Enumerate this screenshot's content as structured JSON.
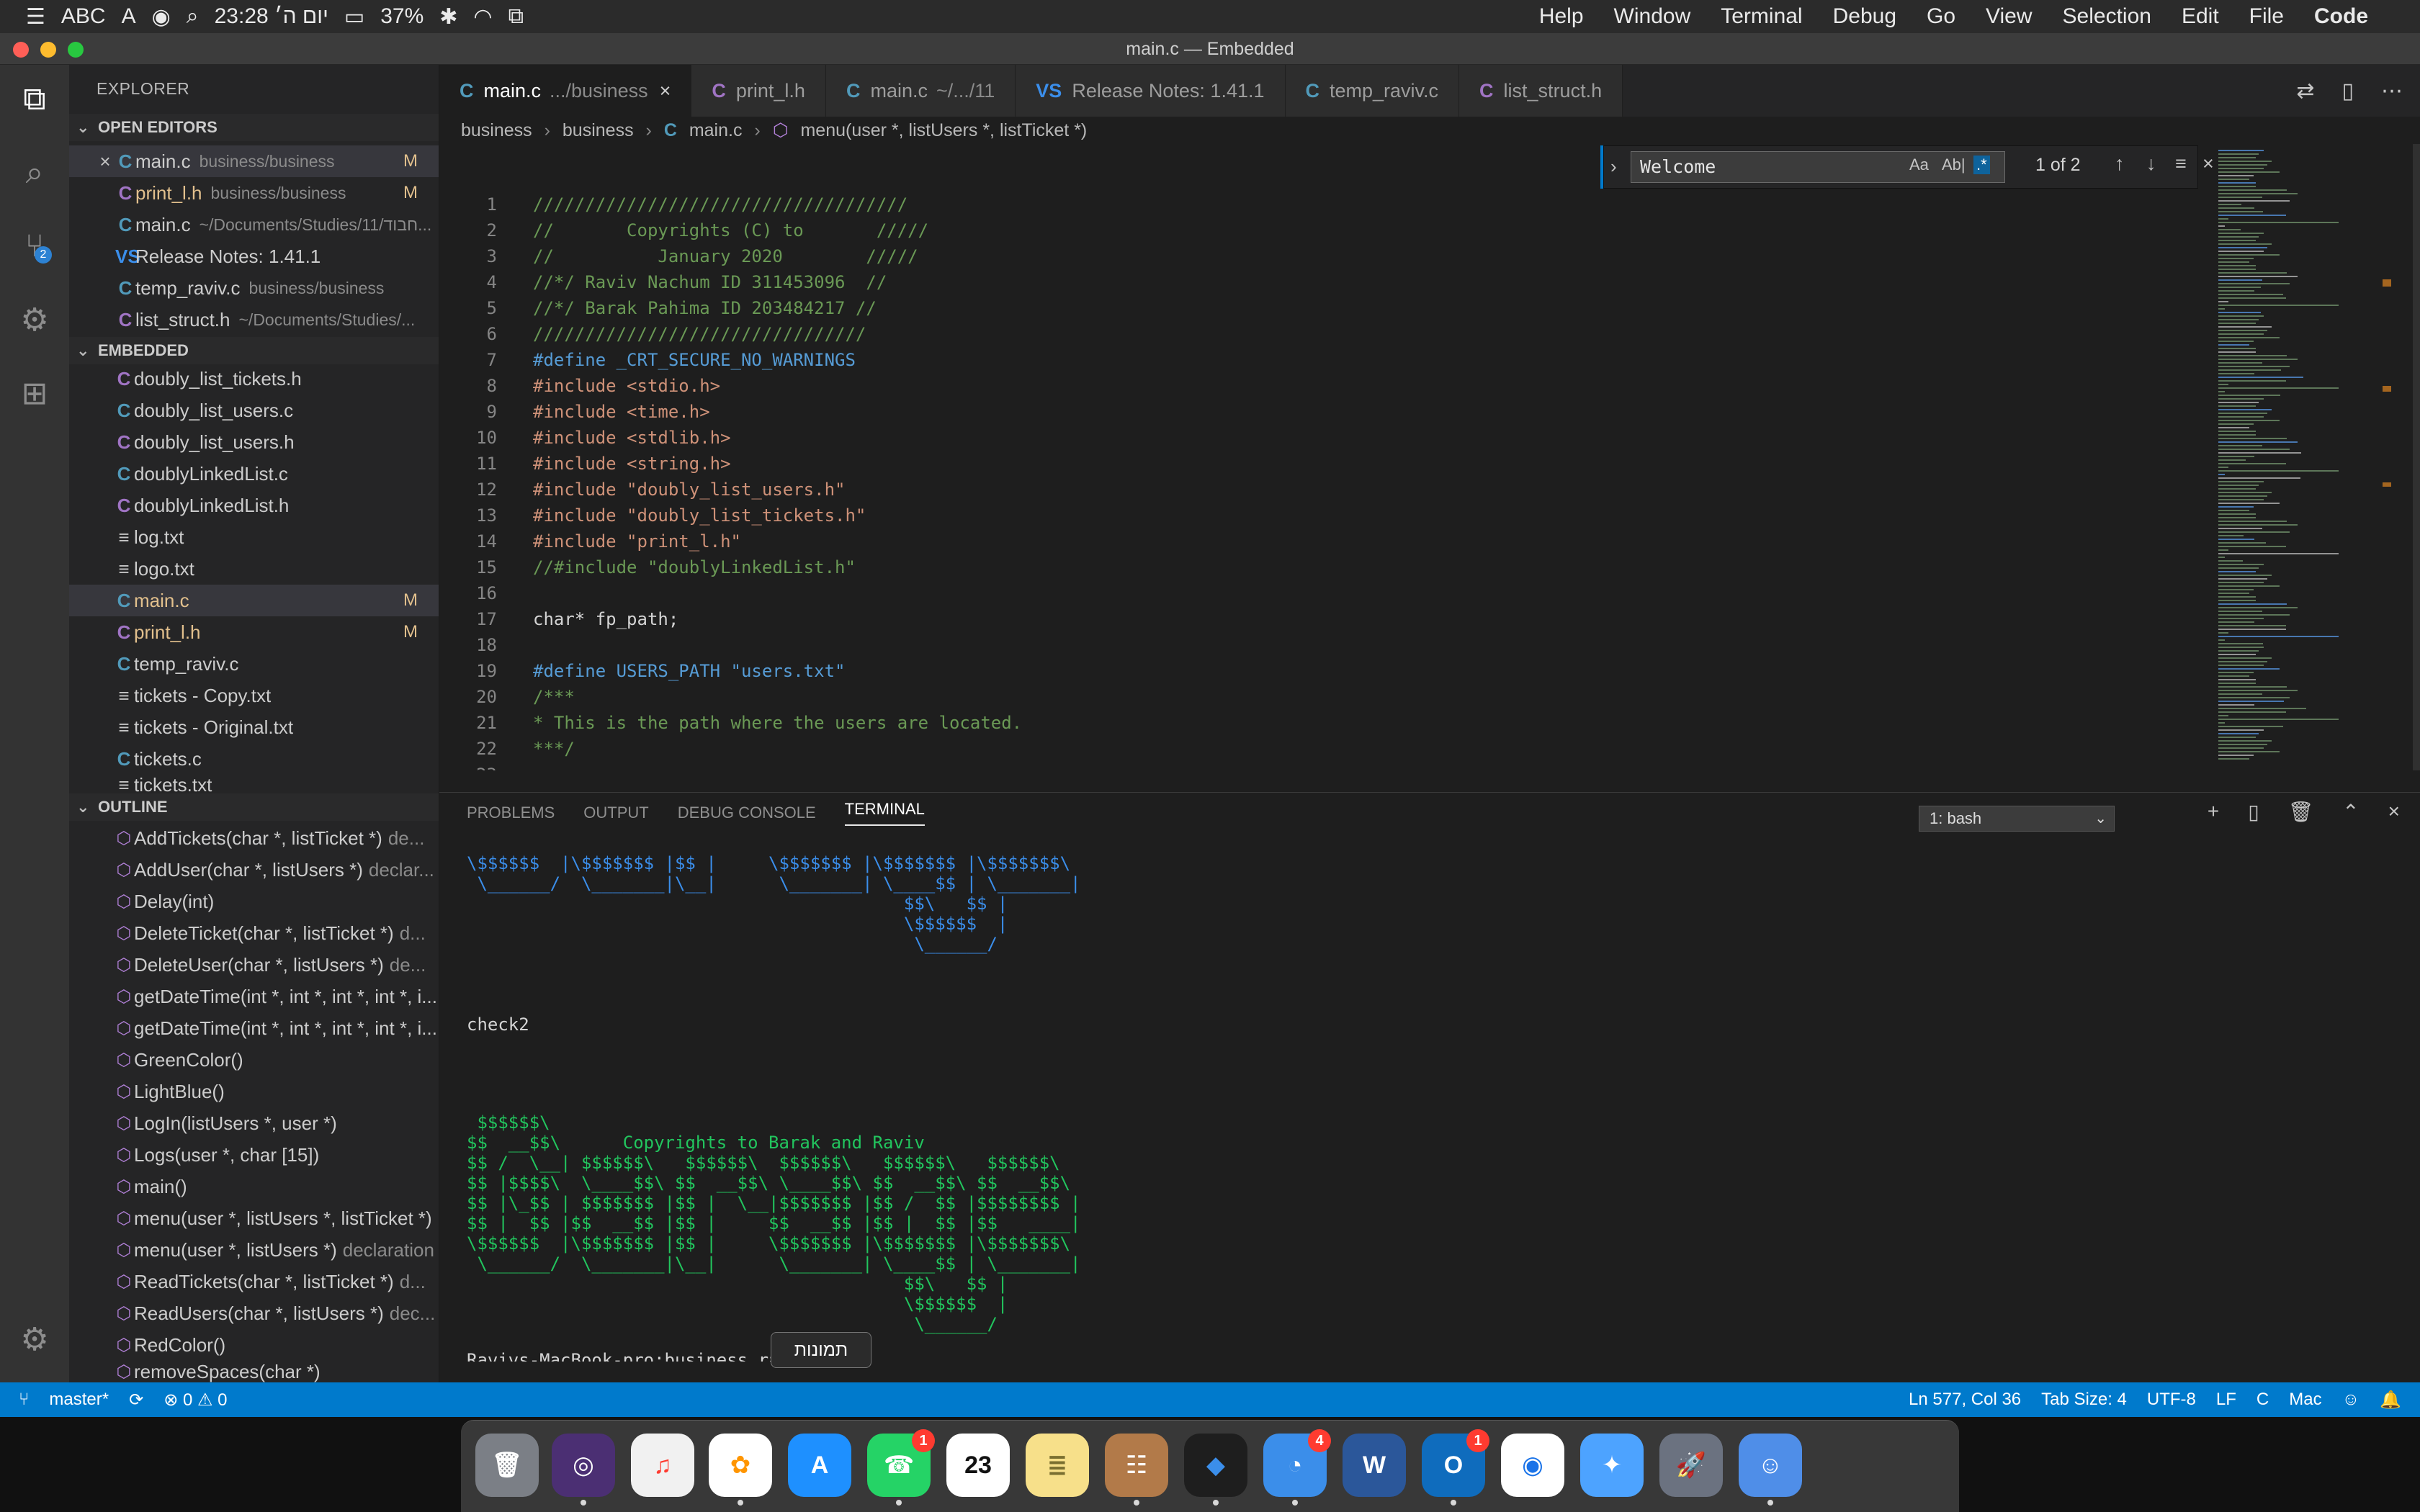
{
  "menubar": {
    "left": {
      "abc": "ABC",
      "a": "A",
      "time": "23:28 יום ה׳",
      "battery": "37%"
    },
    "right": [
      "Help",
      "Window",
      "Terminal",
      "Debug",
      "Go",
      "View",
      "Selection",
      "Edit",
      "File",
      "Code"
    ]
  },
  "window": {
    "title": "main.c — Embedded"
  },
  "sidebar": {
    "header": "EXPLORER",
    "open_editors": {
      "title": "OPEN EDITORS",
      "items": [
        {
          "icon": "C",
          "label": "main.c",
          "meta": "business/business",
          "mod": "M",
          "close": "×"
        },
        {
          "icon": "C",
          "label": "print_l.h",
          "meta": "business/business",
          "mod": "M"
        },
        {
          "icon": "C",
          "label": "main.c",
          "meta": "~/Documents/Studies/11/חבוד..."
        },
        {
          "icon": "VS",
          "label": "Release Notes: 1.41.1",
          "meta": ""
        },
        {
          "icon": "C",
          "label": "temp_raviv.c",
          "meta": "business/business"
        },
        {
          "icon": "C",
          "label": "list_struct.h",
          "meta": "~/Documents/Studies/..."
        }
      ]
    },
    "embedded": {
      "title": "EMBEDDED",
      "items": [
        {
          "icon": "C",
          "label": "doubly_list_tickets.h"
        },
        {
          "icon": "C",
          "label": "doubly_list_users.c"
        },
        {
          "icon": "C",
          "label": "doubly_list_users.h"
        },
        {
          "icon": "C",
          "label": "doublyLinkedList.c"
        },
        {
          "icon": "C",
          "label": "doublyLinkedList.h"
        },
        {
          "icon": "≡",
          "label": "log.txt"
        },
        {
          "icon": "≡",
          "label": "logo.txt"
        },
        {
          "icon": "C",
          "label": "main.c",
          "mod": "M"
        },
        {
          "icon": "C",
          "label": "print_l.h",
          "mod": "M"
        },
        {
          "icon": "C",
          "label": "temp_raviv.c"
        },
        {
          "icon": "≡",
          "label": "tickets - Copy.txt"
        },
        {
          "icon": "≡",
          "label": "tickets - Original.txt"
        },
        {
          "icon": "C",
          "label": "tickets.c"
        },
        {
          "icon": "≡",
          "label": "tickets.txt"
        }
      ]
    },
    "outline": {
      "title": "OUTLINE",
      "items": [
        {
          "label": "AddTickets(char *, listTicket *)",
          "meta": "de..."
        },
        {
          "label": "AddUser(char *, listUsers *)",
          "meta": "declar..."
        },
        {
          "label": "Delay(int)",
          "meta": ""
        },
        {
          "label": "DeleteTicket(char *, listTicket *)",
          "meta": "d..."
        },
        {
          "label": "DeleteUser(char *, listUsers *)",
          "meta": "de..."
        },
        {
          "label": "getDateTime(int *, int *, int *, int *, i...",
          "meta": ""
        },
        {
          "label": "getDateTime(int *, int *, int *, int *, i...",
          "meta": ""
        },
        {
          "label": "GreenColor()",
          "meta": ""
        },
        {
          "label": "LightBlue()",
          "meta": ""
        },
        {
          "label": "LogIn(listUsers *, user *)",
          "meta": ""
        },
        {
          "label": "Logs(user *, char [15])",
          "meta": ""
        },
        {
          "label": "main()",
          "meta": ""
        },
        {
          "label": "menu(user *, listUsers *, listTicket *)",
          "meta": ""
        },
        {
          "label": "menu(user *, listUsers *)",
          "meta": "declaration"
        },
        {
          "label": "ReadTickets(char *, listTicket *)",
          "meta": "d..."
        },
        {
          "label": "ReadUsers(char *, listUsers *)",
          "meta": "dec..."
        },
        {
          "label": "RedColor()",
          "meta": ""
        },
        {
          "label": "removeSpaces(char *)",
          "meta": ""
        }
      ]
    }
  },
  "tabs": [
    {
      "icon": "C",
      "label": "main.c",
      "desc": ".../business",
      "active": true,
      "close": "×"
    },
    {
      "icon": "C",
      "label": "print_l.h",
      "desc": ""
    },
    {
      "icon": "C",
      "label": "main.c",
      "desc": "~/.../11"
    },
    {
      "icon": "VS",
      "label": "Release Notes: 1.41.1",
      "desc": ""
    },
    {
      "icon": "C",
      "label": "temp_raviv.c",
      "desc": ""
    },
    {
      "icon": "C",
      "label": "list_struct.h",
      "desc": ""
    }
  ],
  "breadcrumb": {
    "parts": [
      "business",
      "business",
      "main.c",
      "menu(user *, listUsers *, listTicket *)"
    ]
  },
  "find": {
    "value": "Welcome",
    "count": "1 of 2",
    "opt_case": "Aa",
    "opt_word": "Ab|",
    "opt_regex": ".*"
  },
  "code": [
    {
      "ln": "1",
      "text": "////////////////////////////////////"
    },
    {
      "ln": "2",
      "text": "//       Copyrights (C) to       /////"
    },
    {
      "ln": "3",
      "text": "//          January 2020        /////"
    },
    {
      "ln": "4",
      "text": "//*/ Raviv Nachum ID 311453096  //"
    },
    {
      "ln": "5",
      "text": "//*/ Barak Pahima ID 203484217 //"
    },
    {
      "ln": "6",
      "text": "////////////////////////////////"
    },
    {
      "ln": "7",
      "text": "#define _CRT_SECURE_NO_WARNINGS"
    },
    {
      "ln": "8",
      "text": "#include <stdio.h>"
    },
    {
      "ln": "9",
      "text": "#include <time.h>"
    },
    {
      "ln": "10",
      "text": "#include <stdlib.h>"
    },
    {
      "ln": "11",
      "text": "#include <string.h>"
    },
    {
      "ln": "12",
      "text": "#include \"doubly_list_users.h\""
    },
    {
      "ln": "13",
      "text": "#include \"doubly_list_tickets.h\""
    },
    {
      "ln": "14",
      "text": "#include \"print_l.h\""
    },
    {
      "ln": "15",
      "text": "//#include \"doublyLinkedList.h\""
    },
    {
      "ln": "16",
      "text": ""
    },
    {
      "ln": "17",
      "text": "char* fp_path;"
    },
    {
      "ln": "18",
      "text": ""
    },
    {
      "ln": "19",
      "text": "#define USERS_PATH \"users.txt\""
    },
    {
      "ln": "20",
      "text": "/***"
    },
    {
      "ln": "21",
      "text": "* This is the path where the users are located."
    },
    {
      "ln": "22",
      "text": "***/"
    },
    {
      "ln": "23",
      "text": ""
    }
  ],
  "panel": {
    "tabs": [
      "PROBLEMS",
      "OUTPUT",
      "DEBUG CONSOLE",
      "TERMINAL"
    ],
    "terminal_select": "1: bash",
    "lines_blue": [
      "\\$$$$$$  |\\$$$$$$$ |$$ |     \\$$$$$$$ |\\$$$$$$$ |\\$$$$$$$\\",
      " \\______/  \\_______|\\__|      \\_______| \\____$$ | \\_______|",
      "                                          $$\\   $$ |",
      "                                          \\$$$$$$  |",
      "                                           \\______/"
    ],
    "check": "check2",
    "lines_green": [
      " $$$$$$\\",
      "$$  __$$\\      Copyrights to Barak and Raviv",
      "$$ /  \\__| $$$$$$\\   $$$$$$\\  $$$$$$\\   $$$$$$\\   $$$$$$\\",
      "$$ |$$$$\\  \\____$$\\ $$  __$$\\ \\____$$\\ $$  __$$\\ $$  __$$\\",
      "$$ |\\_$$ | $$$$$$$ |$$ |  \\__|$$$$$$$ |$$ /  $$ |$$$$$$$$ |",
      "$$ |  $$ |$$  __$$ |$$ |     $$  __$$ |$$ |  $$ |$$   ____|",
      "\\$$$$$$  |\\$$$$$$$ |$$ |     \\$$$$$$$ |\\$$$$$$$ |\\$$$$$$$\\",
      " \\______/  \\_______|\\__|      \\_______| \\____$$ | \\_______|",
      "                                          $$\\   $$ |",
      "                                          \\$$$$$$  |",
      "                                           \\______/"
    ],
    "prompt": "Ravivs-MacBook-pro:business rav...",
    "tooltip": "תמונות"
  },
  "status": {
    "branch": "master*",
    "sync": "⟳",
    "problems": "⊗ 0 ⚠ 0",
    "position": "Ln 577, Col 36",
    "tabsize": "Tab Size: 4",
    "encoding": "UTF-8",
    "eol": "LF",
    "lang": "C",
    "platform": "Mac"
  },
  "dock": {
    "badges": {
      "whatsapp": "1",
      "messages": "4",
      "outlook": "1"
    },
    "calendar": "23",
    "word": "W"
  },
  "colors": {
    "accent": "#007acc",
    "comment": "#6a9955",
    "string": "#ce9178",
    "keyword": "#569cd6",
    "terminal_blue": "#3b8eea",
    "terminal_green": "#22c55e"
  }
}
